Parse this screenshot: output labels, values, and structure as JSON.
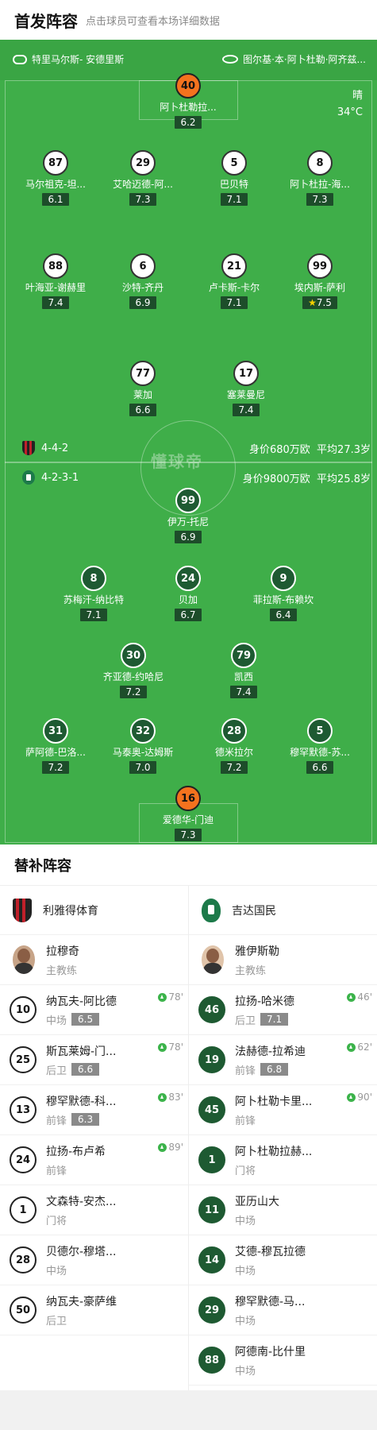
{
  "header": {
    "title": "首发阵容",
    "subtitle": "点击球员可查看本场详细数据"
  },
  "referees": {
    "left": "特里马尔斯- 安德里斯",
    "right": "图尔基·本·阿卜杜勒·阿齐兹..."
  },
  "weather": {
    "condition": "晴",
    "temp": "34°C"
  },
  "watermark": "懂球帝",
  "home_team": {
    "formation": "4-4-2",
    "value": "身价680万欧",
    "age": "平均27.3岁"
  },
  "away_team": {
    "formation": "4-2-3-1",
    "value": "身价9800万欧",
    "age": "平均25.8岁"
  },
  "home_players": [
    {
      "num": "40",
      "name": "阿卜杜勒拉...",
      "rating": "6.2",
      "style": "o"
    },
    {
      "num": "87",
      "name": "马尔祖克-坦...",
      "rating": "6.1",
      "style": "w",
      "sub": "78'"
    },
    {
      "num": "29",
      "name": "艾哈迈德-阿...",
      "rating": "7.3",
      "style": "w",
      "yellow": true
    },
    {
      "num": "5",
      "name": "巴贝特",
      "rating": "7.1",
      "style": "w"
    },
    {
      "num": "8",
      "name": "阿卜杜拉-海...",
      "rating": "7.3",
      "style": "w",
      "captain": "C"
    },
    {
      "num": "88",
      "name": "叶海亚-谢赫里",
      "rating": "7.4",
      "style": "w",
      "sub": "83'"
    },
    {
      "num": "6",
      "name": "沙特-齐丹",
      "rating": "6.9",
      "style": "w",
      "sub": "89'"
    },
    {
      "num": "21",
      "name": "卢卡斯-卡尔",
      "rating": "7.1",
      "style": "w"
    },
    {
      "num": "99",
      "name": "埃内斯-萨利",
      "rating": "7.5",
      "style": "w",
      "star": "★"
    },
    {
      "num": "77",
      "name": "莱加",
      "rating": "6.6",
      "style": "w",
      "sub": "78'"
    },
    {
      "num": "17",
      "name": "塞莱曼尼",
      "rating": "7.4",
      "style": "w",
      "yellow": true
    }
  ],
  "away_players": [
    {
      "num": "99",
      "name": "伊万-托尼",
      "rating": "6.9",
      "style": "d",
      "ball": "⚽"
    },
    {
      "num": "8",
      "name": "苏梅汗-纳比特",
      "rating": "7.1",
      "style": "d",
      "sub": "90'"
    },
    {
      "num": "24",
      "name": "贝加",
      "rating": "6.7",
      "style": "d",
      "sub": "62'"
    },
    {
      "num": "9",
      "name": "菲拉斯-布赖坎",
      "rating": "6.4",
      "style": "d",
      "yellow": true
    },
    {
      "num": "30",
      "name": "齐亚德-约哈尼",
      "rating": "7.2",
      "style": "d"
    },
    {
      "num": "79",
      "name": "凯西",
      "rating": "7.4",
      "style": "d",
      "captain": "C"
    },
    {
      "num": "31",
      "name": "萨阿德-巴洛...",
      "rating": "7.2",
      "style": "d",
      "yellow": true
    },
    {
      "num": "32",
      "name": "马泰奥-达姆斯",
      "rating": "7.0",
      "style": "d"
    },
    {
      "num": "28",
      "name": "德米拉尔",
      "rating": "7.2",
      "style": "d",
      "yellow": true
    },
    {
      "num": "5",
      "name": "穆罕默德-苏...",
      "rating": "6.6",
      "style": "d",
      "sub": "46'"
    },
    {
      "num": "16",
      "name": "爱德华-门迪",
      "rating": "7.3",
      "style": "o"
    }
  ],
  "subs": {
    "title": "替补阵容",
    "left": {
      "team": "利雅得体育",
      "coach": "拉穆奇",
      "coach_role": "主教练",
      "players": [
        {
          "num": "10",
          "name": "纳瓦夫-阿比德",
          "pos": "中场",
          "rating": "6.5",
          "in": "78'"
        },
        {
          "num": "25",
          "name": "斯瓦莱姆-门...",
          "pos": "后卫",
          "rating": "6.6",
          "in": "78'"
        },
        {
          "num": "13",
          "name": "穆罕默德-科...",
          "pos": "前锋",
          "rating": "6.3",
          "in": "83'"
        },
        {
          "num": "24",
          "name": "拉扬-布卢希",
          "pos": "前锋",
          "in": "89'"
        },
        {
          "num": "1",
          "name": "文森特-安杰...",
          "pos": "门将"
        },
        {
          "num": "28",
          "name": "贝德尔-穆塔...",
          "pos": "中场"
        },
        {
          "num": "50",
          "name": "纳瓦夫-豪萨维",
          "pos": "后卫"
        }
      ]
    },
    "right": {
      "team": "吉达国民",
      "coach": "雅伊斯勒",
      "coach_role": "主教练",
      "players": [
        {
          "num": "46",
          "name": "拉扬-哈米德",
          "pos": "后卫",
          "rating": "7.1",
          "in": "46'"
        },
        {
          "num": "19",
          "name": "法赫德-拉希迪",
          "pos": "前锋",
          "rating": "6.8",
          "in": "62'"
        },
        {
          "num": "45",
          "name": "阿卜杜勒卡里...",
          "pos": "前锋",
          "in": "90'"
        },
        {
          "num": "1",
          "name": "阿卜杜勒拉赫...",
          "pos": "门将"
        },
        {
          "num": "11",
          "name": "亚历山大",
          "pos": "中场"
        },
        {
          "num": "14",
          "name": "艾德-穆瓦拉德",
          "pos": "中场"
        },
        {
          "num": "29",
          "name": "穆罕默德-马...",
          "pos": "中场"
        },
        {
          "num": "88",
          "name": "阿德南-比什里",
          "pos": "中场"
        }
      ]
    }
  }
}
